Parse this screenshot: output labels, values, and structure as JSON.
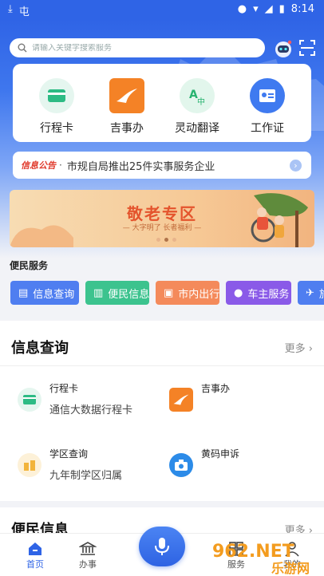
{
  "status_bar": {
    "time": "8:14",
    "app_icon_text": "屯"
  },
  "search": {
    "placeholder": "请输入关键字搜索服务"
  },
  "quick_actions": [
    {
      "label": "行程卡",
      "icon": "card-icon"
    },
    {
      "label": "吉事办",
      "icon": "crane-icon"
    },
    {
      "label": "灵动翻译",
      "icon": "translate-icon"
    },
    {
      "label": "工作证",
      "icon": "id-badge-icon"
    }
  ],
  "notice": {
    "tag": "信息公告",
    "separator": "·",
    "text": "市规自局推出25件实事服务企业"
  },
  "banner": {
    "title": "敬老专区",
    "subtitle": "— 大字明了  长者福利 —"
  },
  "convenience": {
    "label": "便民服务",
    "chips": [
      {
        "label": "信息查询",
        "color": "#4f7ef0"
      },
      {
        "label": "便民信息",
        "color": "#3cc38e"
      },
      {
        "label": "市内出行",
        "color": "#f48a5b"
      },
      {
        "label": "车主服务",
        "color": "#8a5ae8"
      },
      {
        "label": "旅",
        "color": "#4f7ef0"
      }
    ]
  },
  "info_query": {
    "title": "信息查询",
    "more": "更多 ›",
    "items": [
      {
        "name": "行程卡",
        "desc": "通信大数据行程卡",
        "icon": "card-icon"
      },
      {
        "name": "吉事办",
        "desc": "",
        "icon": "crane-icon"
      },
      {
        "name": "学区查询",
        "desc": "九年制学区归属",
        "icon": "school-icon"
      },
      {
        "name": "黄码申诉",
        "desc": "",
        "icon": "camera-icon"
      }
    ]
  },
  "convenience_info": {
    "title": "便民信息",
    "more": "更多 ›"
  },
  "tabbar": {
    "tabs": [
      {
        "label": "首页",
        "active": true
      },
      {
        "label": "办事",
        "active": false
      },
      {
        "label": "服务",
        "active": false
      },
      {
        "label": "我的",
        "active": false
      }
    ]
  },
  "watermark": {
    "line1": "962.NET",
    "line2": "乐游网"
  }
}
